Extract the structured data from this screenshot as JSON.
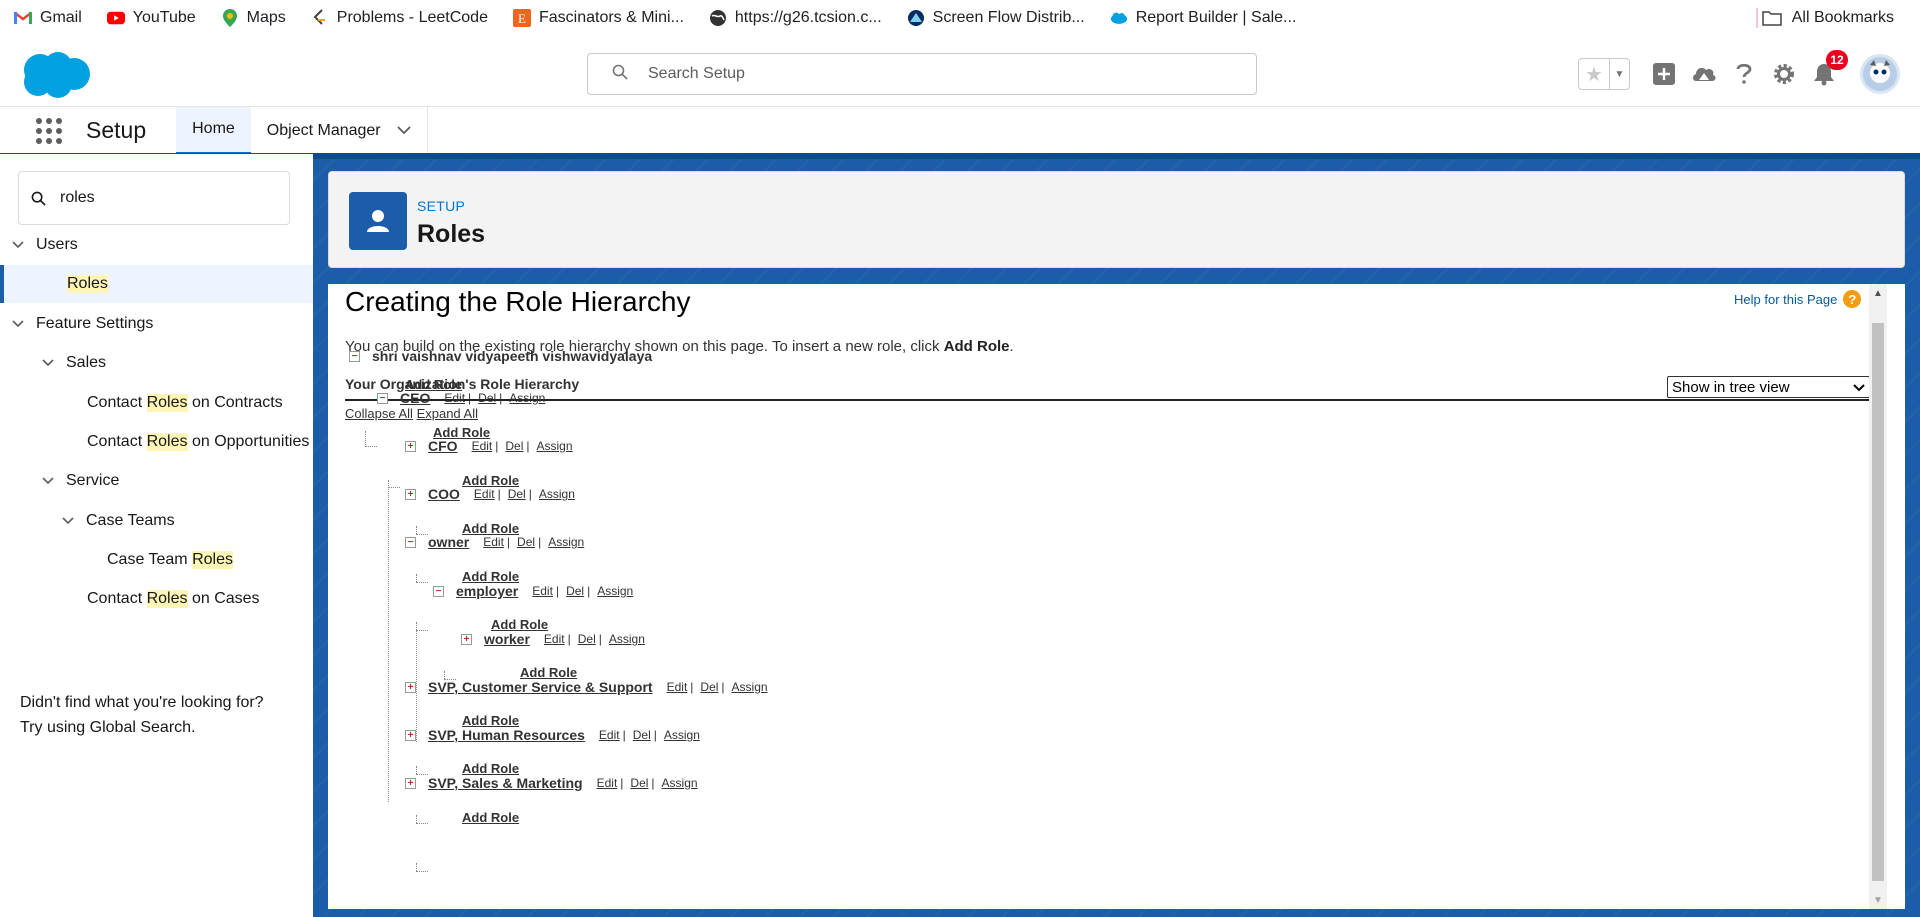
{
  "bookmarks": {
    "items": [
      {
        "label": "Gmail"
      },
      {
        "label": "YouTube"
      },
      {
        "label": "Maps"
      },
      {
        "label": "Problems - LeetCode"
      },
      {
        "label": "Fascinators & Mini..."
      },
      {
        "label": "https://g26.tcsion.c..."
      },
      {
        "label": "Screen Flow Distrib..."
      },
      {
        "label": "Report Builder | Sale..."
      }
    ],
    "all_bookmarks": "All Bookmarks"
  },
  "header": {
    "search_placeholder": "Search Setup",
    "notification_count": "12"
  },
  "app_nav": {
    "app_name": "Setup",
    "tabs": [
      {
        "label": "Home"
      },
      {
        "label": "Object Manager"
      }
    ]
  },
  "sidebar": {
    "quick_find_value": "roles",
    "tree": {
      "users": "Users",
      "roles": "Roles",
      "feature_settings": "Feature Settings",
      "sales": "Sales",
      "contact": "Contact ",
      "roles_word": "Roles",
      "on_contracts": " on Contracts",
      "on_opportunities": " on Opportunities",
      "service": "Service",
      "case_teams": "Case Teams",
      "case_team": "Case Team ",
      "on_cases": " on Cases"
    },
    "not_found_line1": "Didn't find what you're looking for?",
    "not_found_line2": "Try using Global Search."
  },
  "page_header": {
    "eyebrow": "SETUP",
    "title": "Roles"
  },
  "content": {
    "heading": "Creating the Role Hierarchy",
    "help_link": "Help for this Page",
    "intro_text": "You can build on the existing role hierarchy shown on this page. To insert a new role, click ",
    "intro_bold": "Add Role",
    "intro_end": ".",
    "hierarchy_title": "Your Organization's Role Hierarchy",
    "view_option": "Show in tree view",
    "collapse_all": "Collapse All",
    "expand_all": "Expand All",
    "add_role": "Add Role",
    "action_edit": "Edit",
    "action_del": "Del",
    "action_assign": "Assign",
    "root": "shri vaishnav vidyapeeth vishwavidyalaya",
    "roles": {
      "ceo": "CEO",
      "cfo": "CFO",
      "coo": "COO",
      "owner": "owner",
      "employer": "employer",
      "worker": "worker",
      "svp_cs": "SVP, Customer Service & Support",
      "svp_hr": "SVP, Human Resources",
      "svp_sm": "SVP, Sales & Marketing"
    }
  },
  "colors": {
    "brand_blue": "#1b5da8",
    "link_blue": "#0176d3",
    "highlight": "#fcf5b5",
    "badge_red": "#ea001e"
  }
}
